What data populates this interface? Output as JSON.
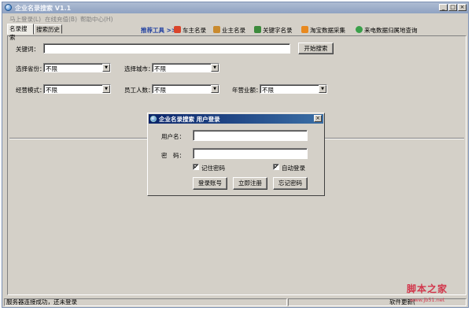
{
  "window": {
    "title": "企业名录搜索 V1.1",
    "minimize_label": "_",
    "maximize_label": "□",
    "close_label": "×"
  },
  "menu": {
    "items": [
      "马上登录(L)",
      "在线充值(B)",
      "帮助中心(H)"
    ]
  },
  "tabs": [
    "名录搜索",
    "搜索历史"
  ],
  "recommend": {
    "heading": "推荐工具 >>",
    "items": [
      {
        "label": "车主名录",
        "icon": "car-owner-icon",
        "color": "#d9452b"
      },
      {
        "label": "业主名录",
        "icon": "property-owner-icon",
        "color": "#c98a2e"
      },
      {
        "label": "关键字名录",
        "icon": "keyword-icon",
        "color": "#3c8a3c"
      },
      {
        "label": "淘宝数据采集",
        "icon": "taobao-icon",
        "color": "#e8891f"
      },
      {
        "label": "来电数据归属地查询",
        "icon": "phone-location-icon",
        "color": "#3aa04a"
      }
    ]
  },
  "search": {
    "keyword_label": "关键词：",
    "keyword_value": "",
    "search_button": "开始搜索",
    "province_label": "选择省份：",
    "province_value": "不限",
    "city_label": "选择城市：",
    "city_value": "不限",
    "business_mode_label": "经营模式：",
    "business_mode_value": "不限",
    "employees_label": "员工人数：",
    "employees_value": "不限",
    "revenue_label": "年营业额：",
    "revenue_value": "不限"
  },
  "login_dialog": {
    "title": "企业名录搜索 用户登录",
    "username_label": "用户名：",
    "username_value": "",
    "password_label": "密　码：",
    "password_value": "",
    "remember_password_label": "记住密码",
    "remember_password_checked": true,
    "auto_login_label": "自动登录",
    "auto_login_checked": true,
    "login_button": "登录账号",
    "register_button": "立即注册",
    "forgot_button": "忘记密码",
    "close_label": "×",
    "check_mark": "✔"
  },
  "status": {
    "left": "服务器连接成功，还未登录",
    "right": "软件更新("
  },
  "watermark": {
    "logo": "脚本之家",
    "url": "www.jb51.net"
  },
  "colors": {
    "face": "#d4d0c8",
    "dialog_title": "#0a246a",
    "recommend_heading": "#1f3fa0",
    "watermark": "#d2374c"
  }
}
